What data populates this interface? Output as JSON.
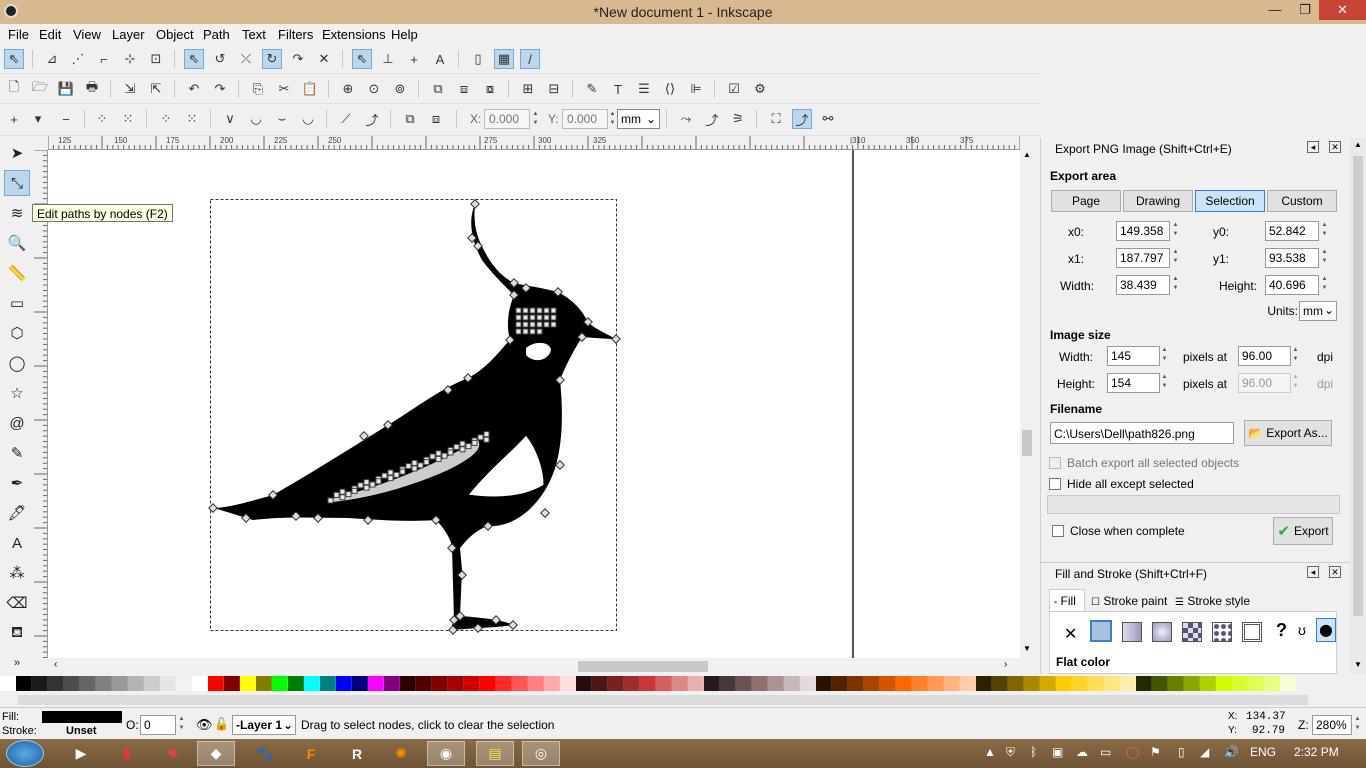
{
  "window": {
    "title": "*New document 1 - Inkscape",
    "min": "—",
    "max": "❐",
    "close": "✕"
  },
  "menu": [
    "File",
    "Edit",
    "View",
    "Layer",
    "Object",
    "Path",
    "Text",
    "Filters",
    "Extensions",
    "Help"
  ],
  "node_toolbar": {
    "x_label": "X:",
    "x_value": "0.000",
    "y_label": "Y:",
    "y_value": "0.000",
    "unit": "mm"
  },
  "tooltip": "Edit paths by nodes (F2)",
  "ruler_top": [
    "125",
    "150",
    "175",
    "200",
    "225",
    "250",
    "275",
    "300",
    "325",
    "350",
    "375"
  ],
  "ruler_top_right": "|310",
  "export_panel": {
    "title": "Export PNG Image (Shift+Ctrl+E)",
    "export_area_title": "Export area",
    "area_buttons": [
      "Page",
      "Drawing",
      "Selection",
      "Custom"
    ],
    "active_area": "Selection",
    "x0_label": "x0:",
    "x0": "149.358",
    "y0_label": "y0:",
    "y0": "52.842",
    "x1_label": "x1:",
    "x1": "187.797",
    "y1_label": "y1:",
    "y1": "93.538",
    "width_label": "Width:",
    "width": "38.439",
    "height_label": "Height:",
    "height": "40.696",
    "units_label": "Units:",
    "units": "mm",
    "image_size_title": "Image size",
    "img_width_label": "Width:",
    "img_width": "145",
    "img_height_label": "Height:",
    "img_height": "154",
    "pixels_at": "pixels at",
    "dpi_x": "96.00",
    "dpi_y": "96.00",
    "dpi": "dpi",
    "filename_title": "Filename",
    "filename": "C:\\Users\\Dell\\path826.png",
    "export_as": "Export As...",
    "batch_export": "Batch export all selected objects",
    "hide_all_except": "Hide all except selected",
    "close_when_complete": "Close when complete",
    "export_button": "Export"
  },
  "fill_panel": {
    "title": "Fill and Stroke (Shift+Ctrl+F)",
    "tabs": [
      "Fill",
      "Stroke paint",
      "Stroke style"
    ],
    "paint_icons": [
      "✕",
      "",
      "",
      "",
      "",
      "",
      "",
      "?",
      "ʊ",
      "⬤"
    ],
    "flat_color": "Flat color"
  },
  "status": {
    "fill_label": "Fill:",
    "stroke_label": "Stroke:",
    "stroke_value": "Unset",
    "opacity_label": "O:",
    "opacity_value": "0",
    "layer": "-Layer 1",
    "message": "Drag to select nodes, click to clear the selection",
    "x_label": "X:",
    "x_value": "134.37",
    "y_label": "Y:",
    "y_value": "92.79",
    "zoom_label": "Z:",
    "zoom_value": "280%"
  },
  "taskbar": {
    "lang": "ENG",
    "time": "2:32 PM",
    "apps": [
      "start",
      "media",
      "app-red",
      "app-gear",
      "inkscape",
      "gimp",
      "foxit",
      "revit",
      "firefox",
      "chrome",
      "explorer",
      "network"
    ]
  },
  "colors": {
    "selection_tab_bg": "#cce4f7",
    "titlebar_bg": "#d8b88e",
    "close_red": "#c74336"
  }
}
